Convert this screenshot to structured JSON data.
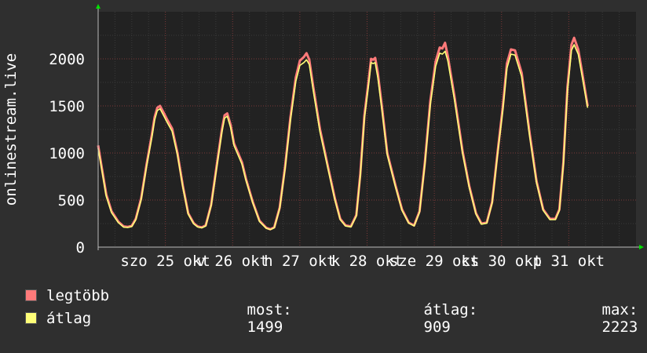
{
  "chart_data": {
    "type": "line",
    "ylabel": "onlinestream.live",
    "xlabel": "",
    "ylim": [
      0,
      2500
    ],
    "yticks": [
      0,
      500,
      1000,
      1500,
      2000
    ],
    "ytick_labels": [
      "0",
      "500",
      "1000",
      "1500",
      "2000"
    ],
    "xlim": [
      0,
      8
    ],
    "xticks": [
      {
        "x": 1.0,
        "label": "szo 25 okt"
      },
      {
        "x": 2.0,
        "label": "v 26 okt"
      },
      {
        "x": 3.0,
        "label": "h 27 okt"
      },
      {
        "x": 4.0,
        "label": "k 28 okt"
      },
      {
        "x": 5.0,
        "label": "sze 29 okt"
      },
      {
        "x": 6.0,
        "label": "cs 30 okt"
      },
      {
        "x": 7.0,
        "label": "p 31 okt"
      }
    ],
    "grid": true,
    "series": [
      {
        "name": "legtöbb",
        "color": "#ff7a7a",
        "x": [
          0.0,
          0.05,
          0.12,
          0.2,
          0.3,
          0.38,
          0.44,
          0.5,
          0.56,
          0.64,
          0.72,
          0.8,
          0.84,
          0.88,
          0.92,
          0.98,
          1.03,
          1.1,
          1.18,
          1.26,
          1.34,
          1.42,
          1.48,
          1.54,
          1.6,
          1.68,
          1.76,
          1.84,
          1.88,
          1.92,
          1.97,
          2.02,
          2.08,
          2.14,
          2.2,
          2.3,
          2.4,
          2.5,
          2.56,
          2.62,
          2.7,
          2.78,
          2.86,
          2.94,
          3.0,
          3.06,
          3.1,
          3.14,
          3.2,
          3.3,
          3.42,
          3.52,
          3.6,
          3.68,
          3.76,
          3.84,
          3.9,
          3.96,
          4.02,
          4.06,
          4.09,
          4.12,
          4.16,
          4.22,
          4.3,
          4.42,
          4.52,
          4.62,
          4.7,
          4.78,
          4.86,
          4.94,
          5.02,
          5.08,
          5.12,
          5.16,
          5.2,
          5.3,
          5.42,
          5.52,
          5.62,
          5.7,
          5.78,
          5.86,
          5.94,
          6.02,
          6.08,
          6.14,
          6.2,
          6.3,
          6.42,
          6.52,
          6.62,
          6.72,
          6.8,
          6.86,
          6.92,
          6.98,
          7.04,
          7.08,
          7.14,
          7.2,
          7.28
        ],
        "values": [
          1080,
          860,
          560,
          380,
          270,
          220,
          215,
          225,
          300,
          520,
          880,
          1200,
          1380,
          1480,
          1500,
          1420,
          1350,
          1260,
          1000,
          650,
          360,
          255,
          220,
          210,
          230,
          450,
          850,
          1250,
          1400,
          1420,
          1300,
          1100,
          1000,
          900,
          720,
          480,
          280,
          205,
          190,
          210,
          420,
          850,
          1380,
          1800,
          1980,
          2020,
          2060,
          1990,
          1700,
          1250,
          850,
          520,
          300,
          230,
          220,
          340,
          780,
          1400,
          1750,
          2000,
          1990,
          2010,
          1850,
          1500,
          1000,
          660,
          400,
          260,
          230,
          380,
          900,
          1550,
          1970,
          2120,
          2110,
          2170,
          2030,
          1600,
          1020,
          650,
          360,
          250,
          260,
          480,
          1000,
          1500,
          1950,
          2100,
          2090,
          1850,
          1200,
          700,
          400,
          300,
          300,
          400,
          900,
          1700,
          2150,
          2223,
          2100,
          1850,
          1499
        ]
      },
      {
        "name": "átlag",
        "color": "#ffff78",
        "x": [
          0.0,
          0.05,
          0.12,
          0.2,
          0.3,
          0.38,
          0.44,
          0.5,
          0.56,
          0.64,
          0.72,
          0.8,
          0.84,
          0.88,
          0.92,
          0.98,
          1.03,
          1.1,
          1.18,
          1.26,
          1.34,
          1.42,
          1.48,
          1.54,
          1.6,
          1.68,
          1.76,
          1.84,
          1.88,
          1.92,
          1.97,
          2.02,
          2.08,
          2.14,
          2.2,
          2.3,
          2.4,
          2.5,
          2.56,
          2.62,
          2.7,
          2.78,
          2.86,
          2.94,
          3.0,
          3.06,
          3.1,
          3.14,
          3.2,
          3.3,
          3.42,
          3.52,
          3.6,
          3.68,
          3.76,
          3.84,
          3.9,
          3.96,
          4.02,
          4.06,
          4.09,
          4.12,
          4.16,
          4.22,
          4.3,
          4.42,
          4.52,
          4.62,
          4.7,
          4.78,
          4.86,
          4.94,
          5.02,
          5.08,
          5.12,
          5.16,
          5.2,
          5.3,
          5.42,
          5.52,
          5.62,
          5.7,
          5.78,
          5.86,
          5.94,
          6.02,
          6.08,
          6.14,
          6.2,
          6.3,
          6.42,
          6.52,
          6.62,
          6.72,
          6.8,
          6.86,
          6.92,
          6.98,
          7.04,
          7.08,
          7.14,
          7.2,
          7.28
        ],
        "values": [
          1050,
          840,
          540,
          365,
          260,
          212,
          208,
          218,
          290,
          505,
          860,
          1170,
          1350,
          1450,
          1470,
          1390,
          1320,
          1230,
          980,
          635,
          350,
          248,
          214,
          204,
          224,
          440,
          830,
          1220,
          1370,
          1390,
          1270,
          1080,
          980,
          880,
          705,
          470,
          272,
          200,
          185,
          205,
          410,
          830,
          1350,
          1760,
          1930,
          1960,
          1990,
          1940,
          1660,
          1220,
          830,
          505,
          292,
          224,
          214,
          330,
          760,
          1370,
          1710,
          1960,
          1950,
          1960,
          1800,
          1465,
          980,
          645,
          390,
          253,
          224,
          370,
          880,
          1510,
          1920,
          2060,
          2050,
          2080,
          1980,
          1565,
          995,
          635,
          350,
          243,
          253,
          468,
          980,
          1465,
          1900,
          2050,
          2040,
          1810,
          1170,
          685,
          390,
          292,
          292,
          390,
          880,
          1660,
          2090,
          2150,
          2050,
          1810,
          1480
        ]
      }
    ]
  },
  "legend": {
    "max_label": "legtöbb",
    "avg_label": "átlag",
    "stats": [
      {
        "label": "most:",
        "value": "1499"
      },
      {
        "label": "átlag:",
        "value": "909"
      },
      {
        "label": "max:",
        "value": "2223"
      }
    ]
  },
  "colors": {
    "background": "#2f2f2f",
    "plot_background": "#222222",
    "grid_minor": "#3a3a3a",
    "grid_major": "#7a3838",
    "axis": "#bbbbbb",
    "arrow": "#00e000",
    "max_series": "#ff7a7a",
    "avg_series": "#ffff78"
  }
}
